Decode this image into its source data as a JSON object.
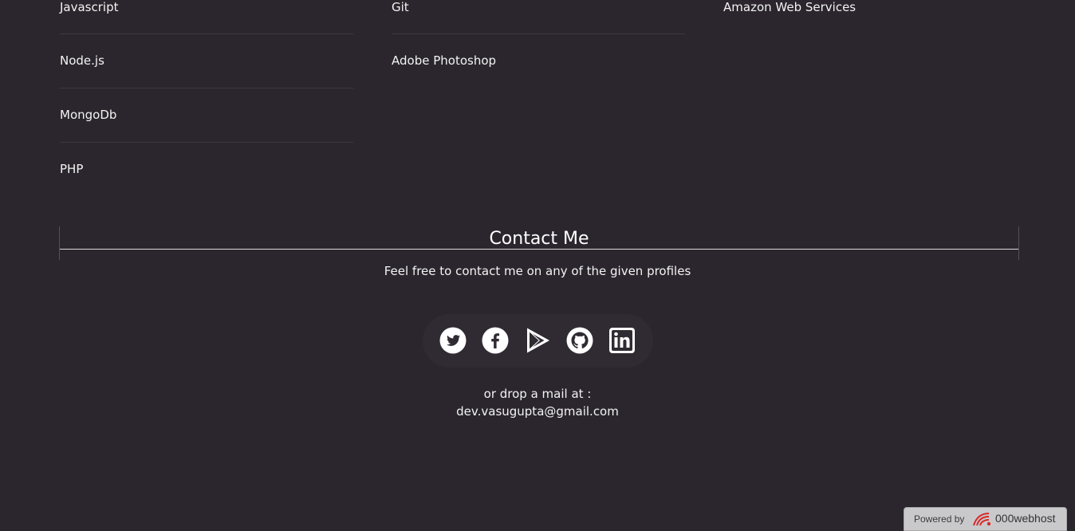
{
  "skills": {
    "column_1": [
      "Javascript",
      "Node.js",
      "MongoDb",
      "PHP"
    ],
    "column_2": [
      "Git",
      "Adobe Photoshop"
    ],
    "column_3": [
      "Amazon Web Services"
    ]
  },
  "contact": {
    "title": "Contact Me",
    "subtitle": "Feel free to contact me on any of the given profiles",
    "social_icons": [
      "twitter-icon",
      "facebook-icon",
      "google-play-icon",
      "github-icon",
      "linkedin-icon"
    ],
    "mail_prefix": "or drop a mail at :",
    "email": "dev.vasugupta@gmail.com"
  },
  "footer_badge": {
    "powered_label": "Powered by",
    "brand": "000webhost"
  },
  "colors": {
    "background": "#2b262d",
    "text": "#ffffff",
    "divider": "#3d383f",
    "badge_background": "#c9c9cc"
  }
}
